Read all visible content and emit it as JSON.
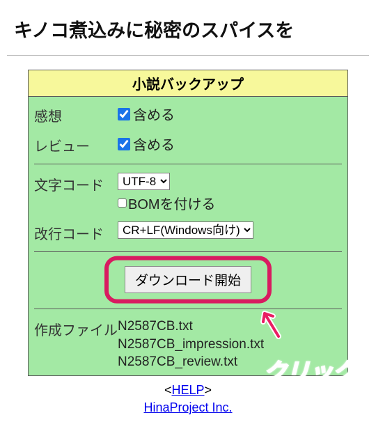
{
  "page_title": "キノコ煮込みに秘密のスパイスを",
  "panel": {
    "header": "小説バックアップ",
    "impressions": {
      "label": "感想",
      "checkbox_label": "含める",
      "checked": true
    },
    "reviews": {
      "label": "レビュー",
      "checkbox_label": "含める",
      "checked": true
    },
    "charset": {
      "label": "文字コード",
      "selected": "UTF-8",
      "bom_label": "BOMを付ける",
      "bom_checked": false
    },
    "newline": {
      "label": "改行コード",
      "selected": "CR+LF(Windows向け)"
    },
    "download_button": "ダウンロード開始",
    "created_files": {
      "label": "作成ファイル",
      "files": [
        "N2587CB.txt",
        "N2587CB_impression.txt",
        "N2587CB_review.txt"
      ]
    }
  },
  "footer": {
    "help_text": "HELP",
    "company_text": "HinaProject Inc."
  },
  "callout": "クリック",
  "colors": {
    "panel_bg": "#a3e9a4",
    "header_bg": "#f7f89b",
    "accent": "#d81b60"
  }
}
